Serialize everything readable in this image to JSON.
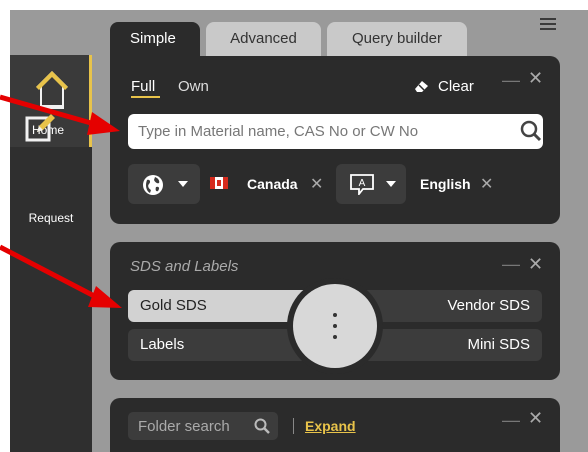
{
  "nav": {
    "items": [
      {
        "label": "Home",
        "icon": "home-icon"
      },
      {
        "label": "Request",
        "icon": "edit-icon"
      }
    ]
  },
  "tabs": [
    {
      "label": "Simple",
      "active": true
    },
    {
      "label": "Advanced"
    },
    {
      "label": "Query builder"
    }
  ],
  "search_panel": {
    "mode_full": "Full",
    "mode_own": "Own",
    "clear_label": "Clear",
    "search": {
      "placeholder": "Type in Material name, CAS No or CW No",
      "value": ""
    },
    "region": {
      "label": "Canada",
      "icon": "globe-icon"
    },
    "language": {
      "label": "English",
      "icon": "language-icon"
    }
  },
  "sds_panel": {
    "title": "SDS and Labels",
    "options": [
      {
        "label": "Gold SDS",
        "selected": true
      },
      {
        "label": "Vendor SDS"
      },
      {
        "label": "Labels"
      },
      {
        "label": "Mini SDS"
      }
    ]
  },
  "folder_panel": {
    "search_placeholder": "Folder search",
    "expand_label": "Expand"
  },
  "colors": {
    "panel": "#2b2b2b",
    "accent": "#e8c34a",
    "annotation_arrow": "#e50000"
  }
}
